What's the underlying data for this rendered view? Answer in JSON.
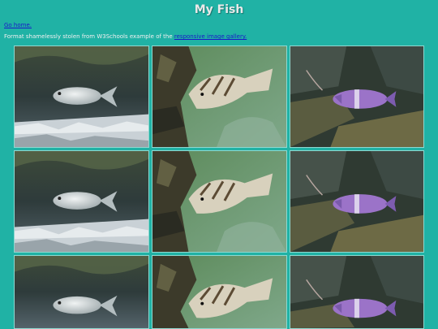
{
  "page": {
    "title": "My Fish",
    "home_link": "Go home.",
    "credit_prefix": "Format shamelessly stolen from W3Schools example of the ",
    "credit_link": "responsive image gallery."
  },
  "gallery": {
    "columns": 3,
    "rows_visible": 3,
    "photos": [
      {
        "subject": "silver-bream-fish"
      },
      {
        "subject": "triggerfish"
      },
      {
        "subject": "purple-wrasse-fish"
      }
    ]
  },
  "colors": {
    "background": "#20b2a5",
    "title_text": "#e9e9e9",
    "link": "#1a18c8"
  }
}
